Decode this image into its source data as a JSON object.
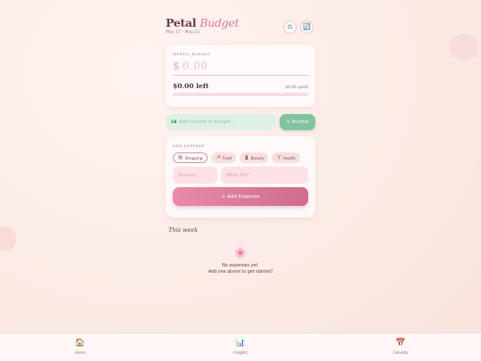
{
  "header": {
    "title_main": "Petal",
    "title_accent": "Budget",
    "date_range": "May 17 – May 23",
    "buttons": [
      {
        "icon": "scale-icon",
        "glyph": "⚖"
      },
      {
        "icon": "calendar-sync-icon",
        "glyph": "🔄"
      }
    ]
  },
  "budget": {
    "label": "WEEKLY BUDGET",
    "currency": "$",
    "amount_placeholder": "0.00",
    "left_text": "$0.00 left",
    "spent_text": "$0.00 spent",
    "progress_fraction": 0
  },
  "income": {
    "placeholder": "Add income to budget...",
    "icon": "money-icon",
    "glyph": "💵",
    "button_label": "+ Income"
  },
  "expense": {
    "label": "ADD EXPENSE",
    "categories": [
      {
        "label": "Shopping",
        "glyph": "🛍",
        "selected": true
      },
      {
        "label": "Food",
        "glyph": "🍜",
        "selected": false
      },
      {
        "label": "Beauty",
        "glyph": "💄",
        "selected": false
      },
      {
        "label": "Health",
        "glyph": "🏋",
        "selected": false
      }
    ],
    "amount_placeholder": "Amount",
    "what_placeholder": "What for?",
    "add_button": "+ Add Expense"
  },
  "week": {
    "heading": "This week",
    "empty_glyph": "🌸",
    "empty_line1": "No expenses yet.",
    "empty_line2": "Add one above to get started!"
  },
  "nav": {
    "items": [
      {
        "label": "Home",
        "glyph": "🏠"
      },
      {
        "label": "Insights",
        "glyph": "📊"
      },
      {
        "label": "Calendar",
        "glyph": "📅"
      }
    ]
  },
  "colors": {
    "accent_pink": "#e48aa3",
    "income_green": "#82c3a1",
    "background": "#fcebe6"
  }
}
